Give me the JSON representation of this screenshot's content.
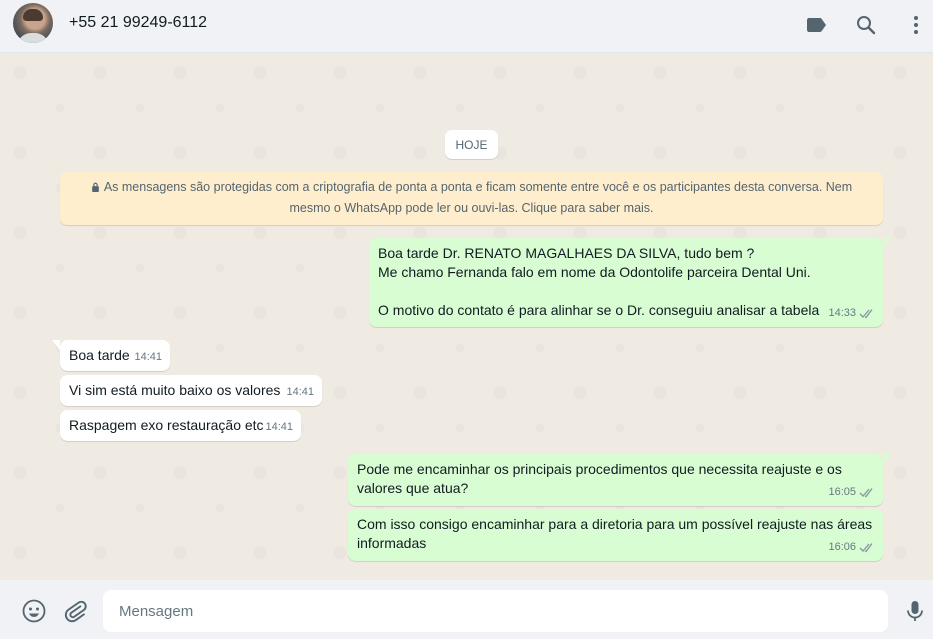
{
  "header": {
    "contact_name": "+55 21 99249-6112",
    "icons": [
      "label-icon",
      "search-icon",
      "menu-icon"
    ]
  },
  "chat": {
    "date_label": "HOJE",
    "encryption_notice": "As mensagens são protegidas com a criptografia de ponta a ponta e ficam somente entre você e os participantes desta conversa. Nem mesmo o WhatsApp pode ler ou ouvi-las. Clique para saber mais.",
    "messages": [
      {
        "direction": "out",
        "text": "Boa tarde Dr. RENATO MAGALHAES DA SILVA, tudo bem ?\nMe chamo Fernanda falo em nome da Odontolife parceira Dental Uni.\n\nO motivo do contato é para alinhar se o Dr. conseguiu analisar a tabela",
        "time": "14:33",
        "status": "read"
      },
      {
        "direction": "in",
        "text": "Boa tarde",
        "time": "14:41"
      },
      {
        "direction": "in",
        "text": "Vi sim está muito baixo os valores",
        "time": "14:41"
      },
      {
        "direction": "in",
        "text": "Raspagem exo restauração etc",
        "time": "14:41"
      },
      {
        "direction": "out",
        "text": "Pode me encaminhar os principais procedimentos que necessita reajuste e os valores que atua?",
        "time": "16:05",
        "status": "read"
      },
      {
        "direction": "out",
        "text": "Com isso consigo encaminhar para a diretoria para um possível reajuste nas áreas informadas",
        "time": "16:06",
        "status": "read"
      }
    ]
  },
  "footer": {
    "input_placeholder": "Mensagem",
    "icons": [
      "emoji-icon",
      "attach-icon",
      "mic-icon"
    ]
  },
  "colors": {
    "outgoing_bubble": "#d9fdd3",
    "incoming_bubble": "#ffffff",
    "chat_background": "#efeae2",
    "notice_background": "#ffeecd",
    "read_ticks": "#8696a0"
  }
}
